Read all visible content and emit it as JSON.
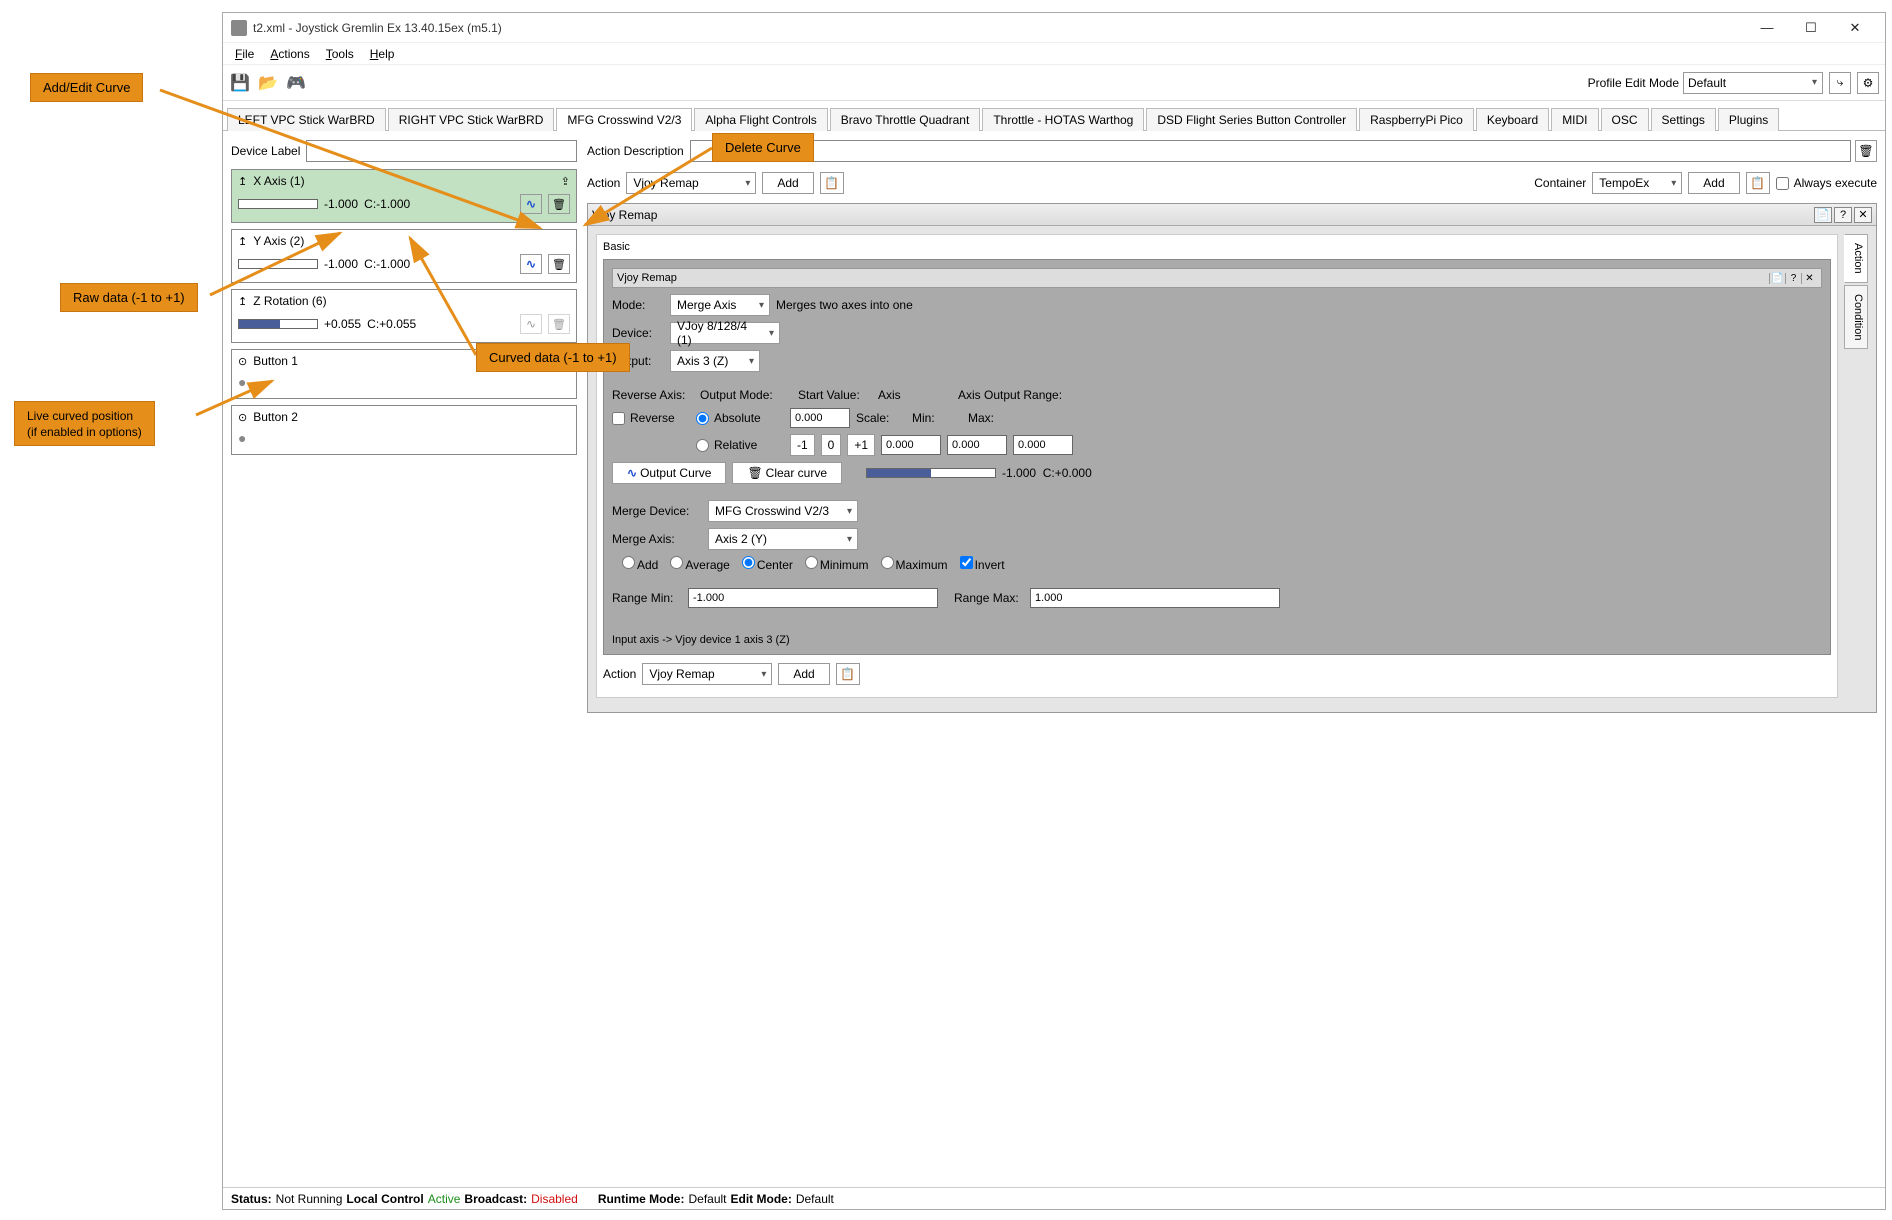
{
  "window": {
    "title": "t2.xml - Joystick Gremlin Ex 13.40.15ex (m5.1)"
  },
  "menu": {
    "file": "File",
    "actions": "Actions",
    "tools": "Tools",
    "help": "Help"
  },
  "toolbar": {
    "profile_mode_label": "Profile Edit Mode",
    "profile_mode_value": "Default"
  },
  "device_tabs": [
    "LEFT VPC Stick WarBRD",
    "RIGHT VPC Stick WarBRD",
    "MFG Crosswind V2/3",
    "Alpha Flight Controls",
    "Bravo Throttle Quadrant",
    "Throttle - HOTAS Warthog",
    "DSD Flight Series Button Controller",
    "RaspberryPi Pico",
    "Keyboard",
    "MIDI",
    "OSC",
    "Settings",
    "Plugins"
  ],
  "left": {
    "device_label": "Device Label",
    "inputs": [
      {
        "name": "X Axis (1)",
        "raw": "-1.000",
        "curved": "C:-1.000",
        "barfill": 0,
        "active": true,
        "curve_enabled": true
      },
      {
        "name": "Y Axis (2)",
        "raw": "-1.000",
        "curved": "C:-1.000",
        "barfill": 0,
        "active": false,
        "curve_enabled": true
      },
      {
        "name": "Z Rotation (6)",
        "raw": "+0.055",
        "curved": "C:+0.055",
        "barfill": 52,
        "active": false,
        "curve_enabled": false
      },
      {
        "name": "Button 1",
        "type": "button"
      },
      {
        "name": "Button 2",
        "type": "button"
      }
    ]
  },
  "right": {
    "action_desc_label": "Action Description",
    "action_label": "Action",
    "action_value": "Vjoy Remap",
    "add": "Add",
    "container_label": "Container",
    "container_value": "TempoEx",
    "always_execute": "Always execute",
    "panel_title": "Vjoy Remap",
    "sidetab1": "Action",
    "sidetab2": "Condition",
    "basic": "Basic",
    "inner_title": "Vjoy Remap",
    "mode_label": "Mode:",
    "mode_value": "Merge Axis",
    "mode_hint": "Merges two axes into one",
    "device_label": "Device:",
    "device_value": "VJoy 8/128/4 (1)",
    "output_label": "Output:",
    "output_value": "Axis 3 (Z)",
    "reverse_axis_label": "Reverse Axis:",
    "output_mode_label": "Output Mode:",
    "start_value_label": "Start Value:",
    "axis_label": "Axis",
    "axis_output_range_label": "Axis Output Range:",
    "reverse": "Reverse",
    "absolute": "Absolute",
    "relative": "Relative",
    "start_value": "0.000",
    "scale_label": "Scale:",
    "min_label": "Min:",
    "max_label": "Max:",
    "minus1": "-1",
    "zero": "0",
    "plus1": "+1",
    "scale_value": "0.000",
    "min_value": "0.000",
    "max_value": "0.000",
    "output_curve_btn": "Output Curve",
    "clear_curve_btn": "Clear curve",
    "curve_raw": "-1.000",
    "curve_curved": "C:+0.000",
    "merge_device_label": "Merge Device:",
    "merge_device_value": "MFG Crosswind V2/3",
    "merge_axis_label": "Merge Axis:",
    "merge_axis_value": "Axis 2 (Y)",
    "op_add": "Add",
    "op_average": "Average",
    "op_center": "Center",
    "op_minimum": "Minimum",
    "op_maximum": "Maximum",
    "op_invert": "Invert",
    "range_min_label": "Range Min:",
    "range_min_value": "-1.000",
    "range_max_label": "Range Max:",
    "range_max_value": "1.000",
    "mapping_text": "Input axis -> Vjoy device 1 axis 3 (Z)",
    "action2_label": "Action",
    "action2_value": "Vjoy Remap",
    "add2": "Add"
  },
  "status": {
    "status_lbl": "Status:",
    "status_val": "Not Running",
    "local_lbl": "Local Control",
    "local_val": "Active",
    "broadcast_lbl": "Broadcast:",
    "broadcast_val": "Disabled",
    "runtime_lbl": "Runtime Mode:",
    "runtime_val": "Default",
    "edit_lbl": "Edit Mode:",
    "edit_val": "Default"
  },
  "annotations": {
    "add_edit": "Add/Edit Curve",
    "delete": "Delete Curve",
    "raw": "Raw data (-1 to +1)",
    "curved": "Curved data (-1 to +1)",
    "live": "Live curved position\n(if enabled in options)",
    "live_l1": "Live curved position",
    "live_l2": "(if enabled in options)"
  }
}
